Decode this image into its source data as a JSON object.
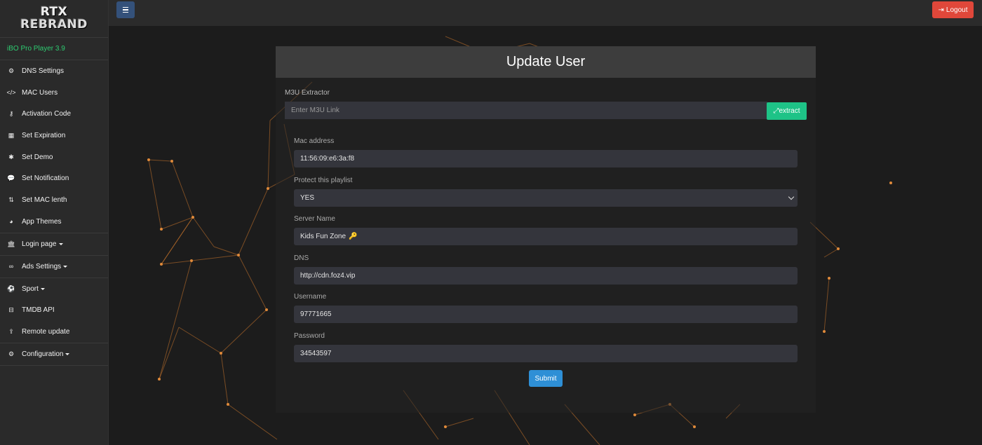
{
  "brand": {
    "line1": "RTX",
    "line2": "REBRAND"
  },
  "version": "iBO Pro Player 3.9",
  "sidebar": {
    "items": [
      {
        "label": "DNS Settings",
        "icon": "cogs-icon"
      },
      {
        "label": "MAC Users",
        "icon": "code-icon"
      },
      {
        "label": "Activation Code",
        "icon": "key-icon"
      },
      {
        "label": "Set Expiration",
        "icon": "calendar-icon"
      },
      {
        "label": "Set Demo",
        "icon": "asterisk-icon"
      },
      {
        "label": "Set Notification",
        "icon": "comment-icon"
      },
      {
        "label": "Set MAC lenth",
        "icon": "sort-icon"
      },
      {
        "label": "App Themes",
        "icon": "palette-icon"
      },
      {
        "label": "Login page",
        "icon": "bank-icon"
      },
      {
        "label": "Ads Settings",
        "icon": "binoculars-icon"
      },
      {
        "label": "Sport",
        "icon": "soccer-ball-icon"
      },
      {
        "label": "TMDB API",
        "icon": "minus-square-icon"
      },
      {
        "label": "Remote update",
        "icon": "upload-icon"
      },
      {
        "label": "Configuration",
        "icon": "gear-icon"
      }
    ]
  },
  "topbar": {
    "logout_label": "Logout"
  },
  "form": {
    "title": "Update User",
    "m3u_label": "M3U Extractor",
    "m3u_placeholder": "Enter M3U Link",
    "extract_label": "extract",
    "mac_label": "Mac address",
    "mac_value": "11:56:09:e6:3a:f8",
    "protect_label": "Protect this playlist",
    "protect_value": "YES",
    "server_label": "Server Name",
    "server_value": "Kids Fun Zone",
    "dns_label": "DNS",
    "dns_value": "http://cdn.foz4.vip",
    "username_label": "Username",
    "username_value": "97771665",
    "password_label": "Password",
    "password_value": "34543597",
    "submit_label": "Submit"
  },
  "colors": {
    "accent_green": "#1ec387",
    "logout_red": "#e0473a",
    "submit_blue": "#2e8fd6",
    "network_orange": "#e08a3a"
  }
}
